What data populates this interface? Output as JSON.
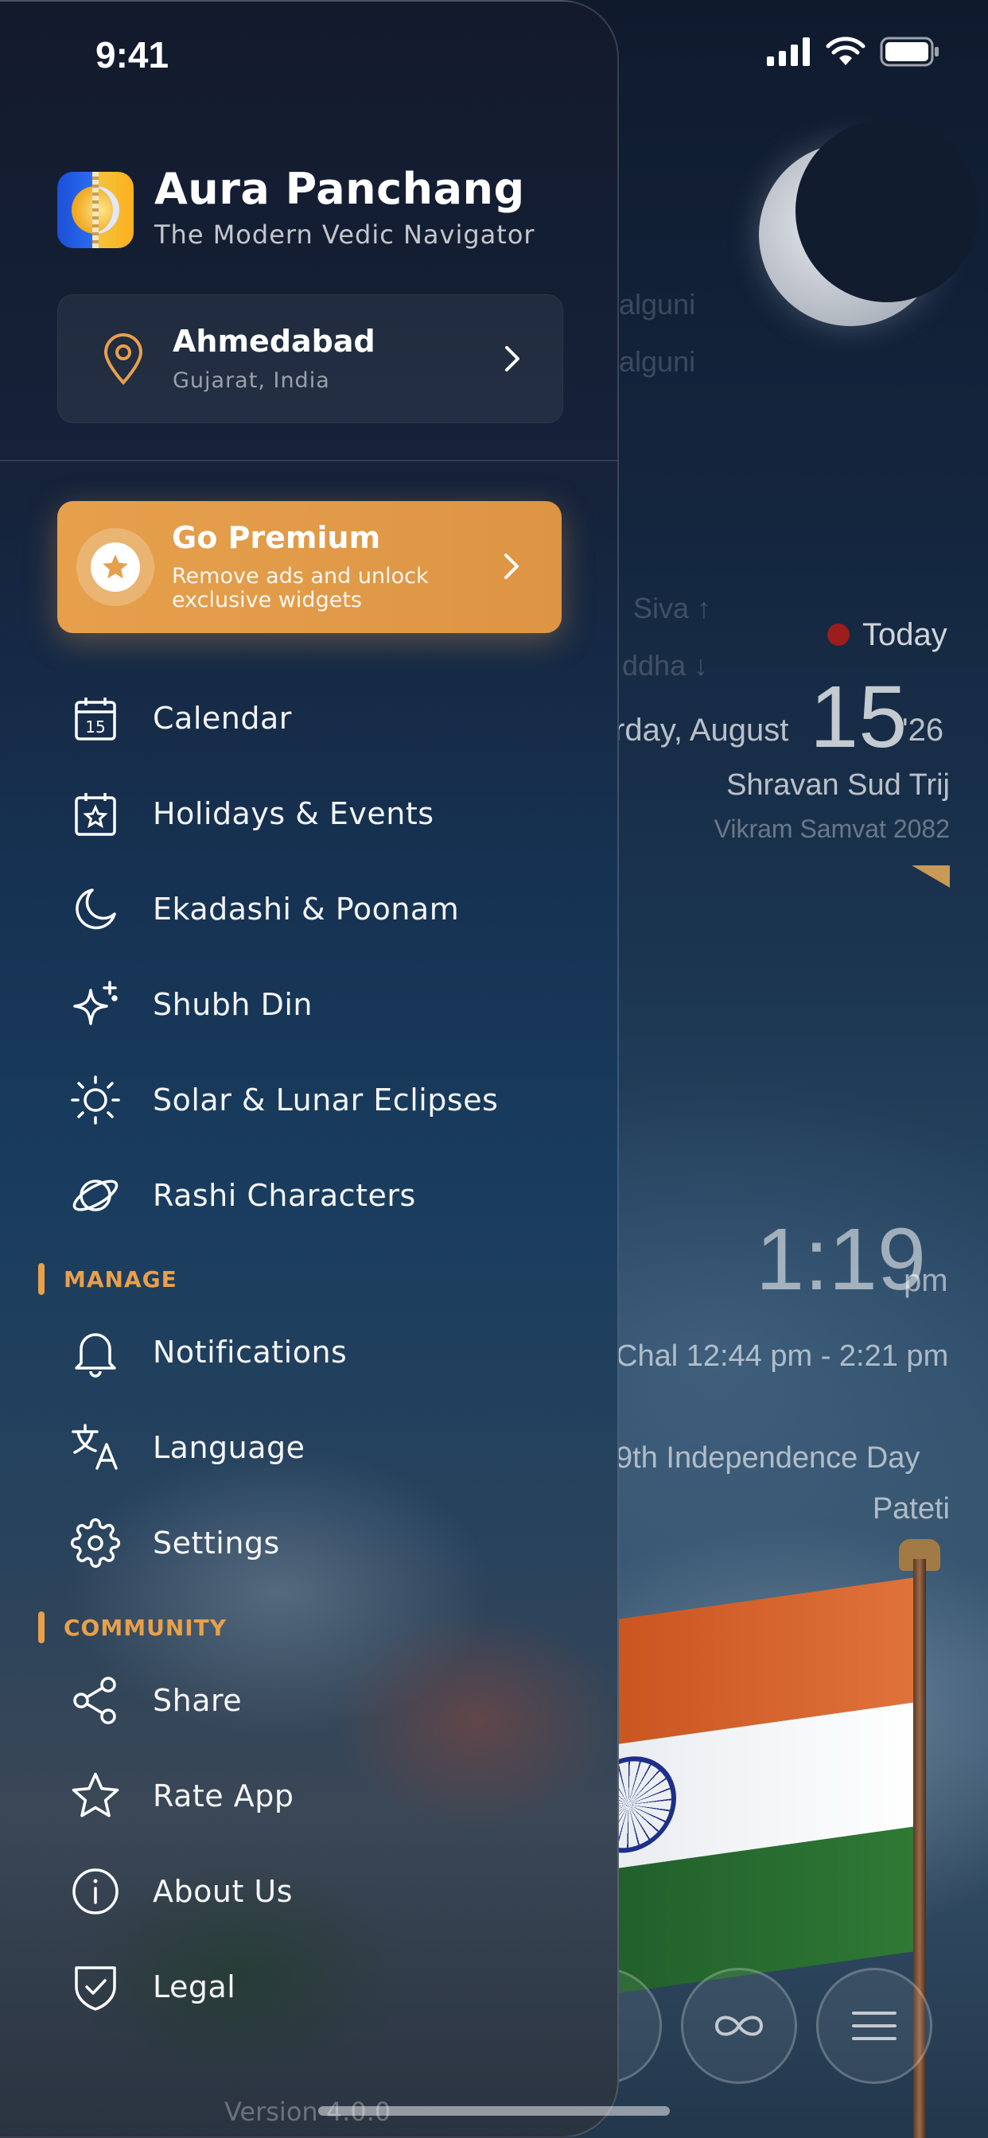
{
  "status_bar": {
    "time": "9:41"
  },
  "background_view": {
    "faded_lines": [
      "algunі",
      "algunі",
      "Siva ↑",
      "ddha ↓"
    ],
    "today_label": "Today",
    "weekday_month": "rday, August",
    "day": "15",
    "year": "'26",
    "tithi": "Shravan Sud Trij",
    "samvat": "Vikram Samvat 2082",
    "clock_time": "1:19",
    "clock_period": "pm",
    "choghadiya": "Chal 12:44 pm - 2:21 pm",
    "event_1": "9th Independence Day",
    "event_2": "Pateti"
  },
  "drawer": {
    "app_title": "Aura Panchang",
    "app_subtitle": "The Modern Vedic Navigator",
    "location": {
      "city": "Ahmedabad",
      "region": "Gujarat, India"
    },
    "premium": {
      "title": "Go Premium",
      "subtitle": "Remove ads and unlock exclusive widgets"
    },
    "main_items": [
      {
        "label": "Calendar",
        "icon": "calendar-icon"
      },
      {
        "label": "Holidays & Events",
        "icon": "calendar-star-icon"
      },
      {
        "label": "Ekadashi & Poonam",
        "icon": "moon-icon"
      },
      {
        "label": "Shubh Din",
        "icon": "sparkle-icon"
      },
      {
        "label": "Solar & Lunar Eclipses",
        "icon": "sun-icon"
      },
      {
        "label": "Rashi Characters",
        "icon": "planet-icon"
      }
    ],
    "manage_header": "MANAGE",
    "manage_items": [
      {
        "label": "Notifications",
        "icon": "bell-icon"
      },
      {
        "label": "Language",
        "icon": "translate-icon"
      },
      {
        "label": "Settings",
        "icon": "gear-icon"
      }
    ],
    "community_header": "COMMUNITY",
    "community_items": [
      {
        "label": "Share",
        "icon": "share-icon"
      },
      {
        "label": "Rate App",
        "icon": "star-icon"
      },
      {
        "label": "About Us",
        "icon": "info-icon"
      },
      {
        "label": "Legal",
        "icon": "shield-check-icon"
      }
    ],
    "version": "Version 4.0.0"
  },
  "colors": {
    "accent": "#E8A04A",
    "today_dot": "#9B1D1D"
  }
}
